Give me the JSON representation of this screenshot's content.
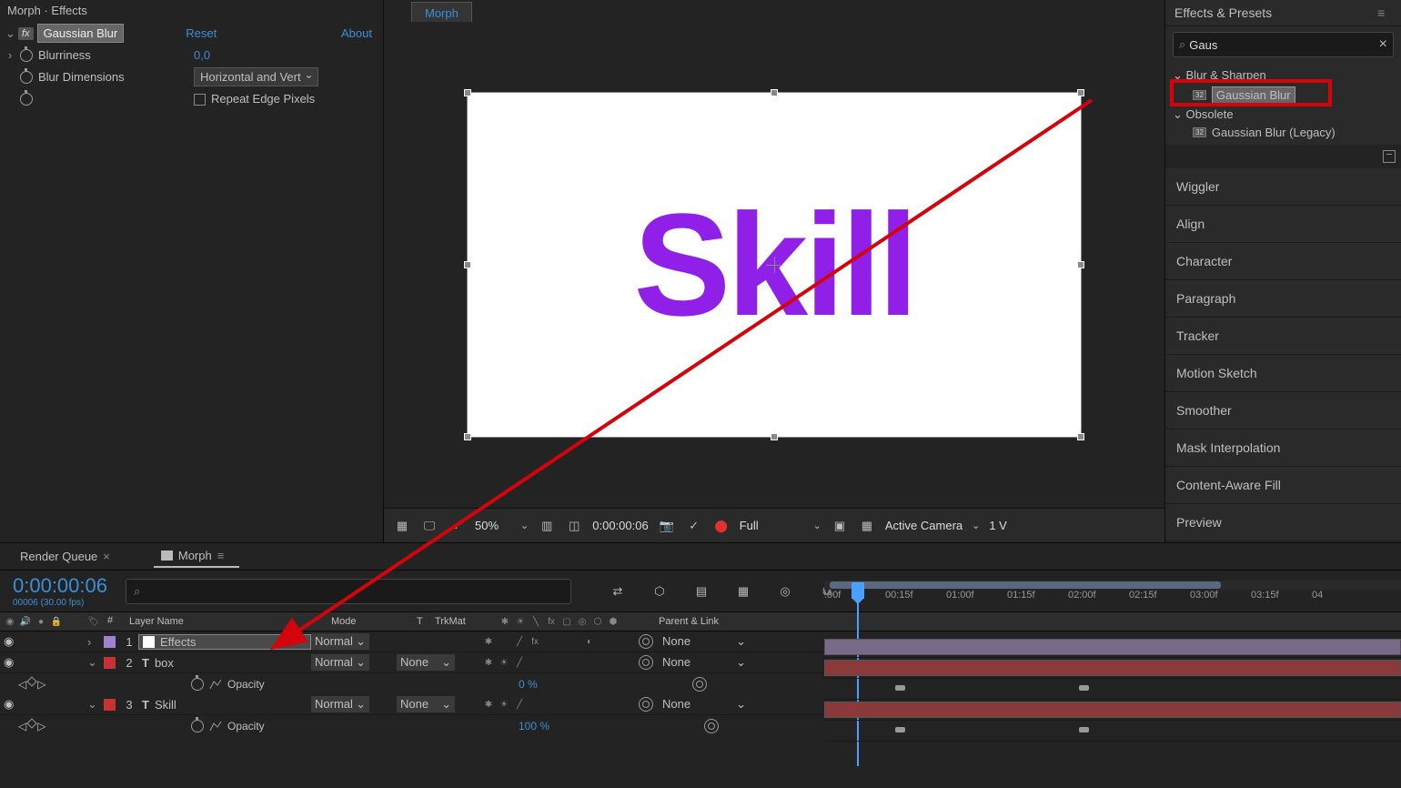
{
  "effect_controls": {
    "title": "Morph · Effects",
    "effect_name": "Gaussian Blur",
    "reset": "Reset",
    "about": "About",
    "blurriness_label": "Blurriness",
    "blurriness_value": "0,0",
    "dimensions_label": "Blur Dimensions",
    "dimensions_value": "Horizontal and Vert",
    "repeat_label": "Repeat Edge Pixels"
  },
  "viewer": {
    "tab": "Morph",
    "text": "Skill",
    "zoom": "50%",
    "timecode": "0:00:00:06",
    "resolution": "Full",
    "camera": "Active Camera",
    "view": "1 V"
  },
  "effects_presets": {
    "header": "Effects & Presets",
    "search": "Gaus",
    "group1": "Blur & Sharpen",
    "item1": "Gaussian Blur",
    "group2": "Obsolete",
    "item2": "Gaussian Blur (Legacy)"
  },
  "panels": [
    "Wiggler",
    "Align",
    "Character",
    "Paragraph",
    "Tracker",
    "Motion Sketch",
    "Smoother",
    "Mask Interpolation",
    "Content-Aware Fill",
    "Preview"
  ],
  "timeline": {
    "tabs": {
      "render": "Render Queue",
      "morph": "Morph"
    },
    "timecode": "0:00:00:06",
    "framerate": "00006 (30.00 fps)",
    "columns": {
      "name": "Layer Name",
      "mode": "Mode",
      "t": "T",
      "trkmat": "TrkMat",
      "parent": "Parent & Link",
      "num": "#"
    },
    "layers": [
      {
        "num": "1",
        "name": "Effects",
        "mode": "Normal",
        "trkmat": "",
        "parent": "None"
      },
      {
        "num": "2",
        "name": "box",
        "mode": "Normal",
        "trkmat": "None",
        "parent": "None",
        "opacity_label": "Opacity",
        "opacity_value": "0 %"
      },
      {
        "num": "3",
        "name": "Skill",
        "mode": "Normal",
        "trkmat": "None",
        "parent": "None",
        "opacity_label": "Opacity",
        "opacity_value": "100 %"
      }
    ],
    "ruler": [
      ":00f",
      "00:15f",
      "01:00f",
      "01:15f",
      "02:00f",
      "02:15f",
      "03:00f",
      "03:15f",
      "04"
    ]
  }
}
